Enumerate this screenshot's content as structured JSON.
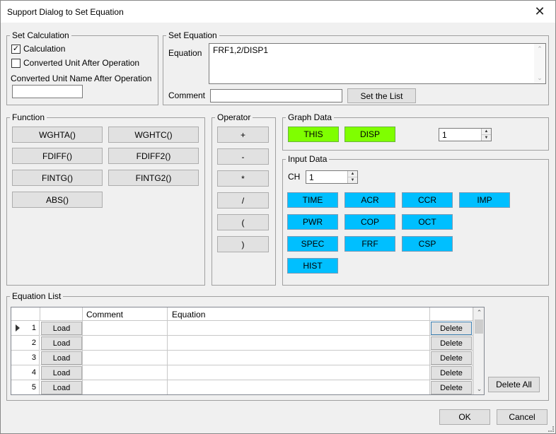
{
  "window": {
    "title": "Support Dialog to Set Equation",
    "close_glyph": "✕"
  },
  "set_calculation": {
    "legend": "Set Calculation",
    "calculation": {
      "label": "Calculation",
      "checked": true
    },
    "converted_unit": {
      "label": "Converted Unit After Operation",
      "checked": false
    },
    "unit_name_label": "Converted Unit Name After Operation",
    "unit_name_value": ""
  },
  "set_equation": {
    "legend": "Set Equation",
    "equation_label": "Equation",
    "equation_value": "FRF1,2/DISP1",
    "comment_label": "Comment",
    "comment_value": "",
    "set_list_button": "Set the List"
  },
  "function": {
    "legend": "Function",
    "buttons": [
      "WGHTA()",
      "WGHTC()",
      "FDIFF()",
      "FDIFF2()",
      "FINTG()",
      "FINTG2()",
      "ABS()"
    ]
  },
  "operator": {
    "legend": "Operator",
    "buttons": [
      "+",
      "-",
      "*",
      "/",
      "(",
      ")"
    ]
  },
  "graph_data": {
    "legend": "Graph Data",
    "buttons": [
      "THIS",
      "DISP"
    ],
    "spin_value": "1",
    "button_color": "#7fff00"
  },
  "input_data": {
    "legend": "Input Data",
    "ch_label": "CH",
    "ch_value": "1",
    "buttons": [
      "TIME",
      "ACR",
      "CCR",
      "IMP",
      "PWR",
      "COP",
      "OCT",
      "SPEC",
      "FRF",
      "CSP",
      "HIST"
    ],
    "button_color": "#00bfff"
  },
  "equation_list": {
    "legend": "Equation List",
    "columns": [
      "",
      "",
      "Comment",
      "Equation",
      ""
    ],
    "rows": [
      {
        "num": "1",
        "load": "Load",
        "comment": "",
        "equation": "",
        "delete": "Delete"
      },
      {
        "num": "2",
        "load": "Load",
        "comment": "",
        "equation": "",
        "delete": "Delete"
      },
      {
        "num": "3",
        "load": "Load",
        "comment": "",
        "equation": "",
        "delete": "Delete"
      },
      {
        "num": "4",
        "load": "Load",
        "comment": "",
        "equation": "",
        "delete": "Delete"
      },
      {
        "num": "5",
        "load": "Load",
        "comment": "",
        "equation": "",
        "delete": "Delete"
      }
    ],
    "delete_all": "Delete All"
  },
  "footer": {
    "ok": "OK",
    "cancel": "Cancel"
  },
  "icons": {
    "check": "✓",
    "up": "▲",
    "down": "▼",
    "scroll_up": "⌃",
    "scroll_down": "⌄"
  }
}
